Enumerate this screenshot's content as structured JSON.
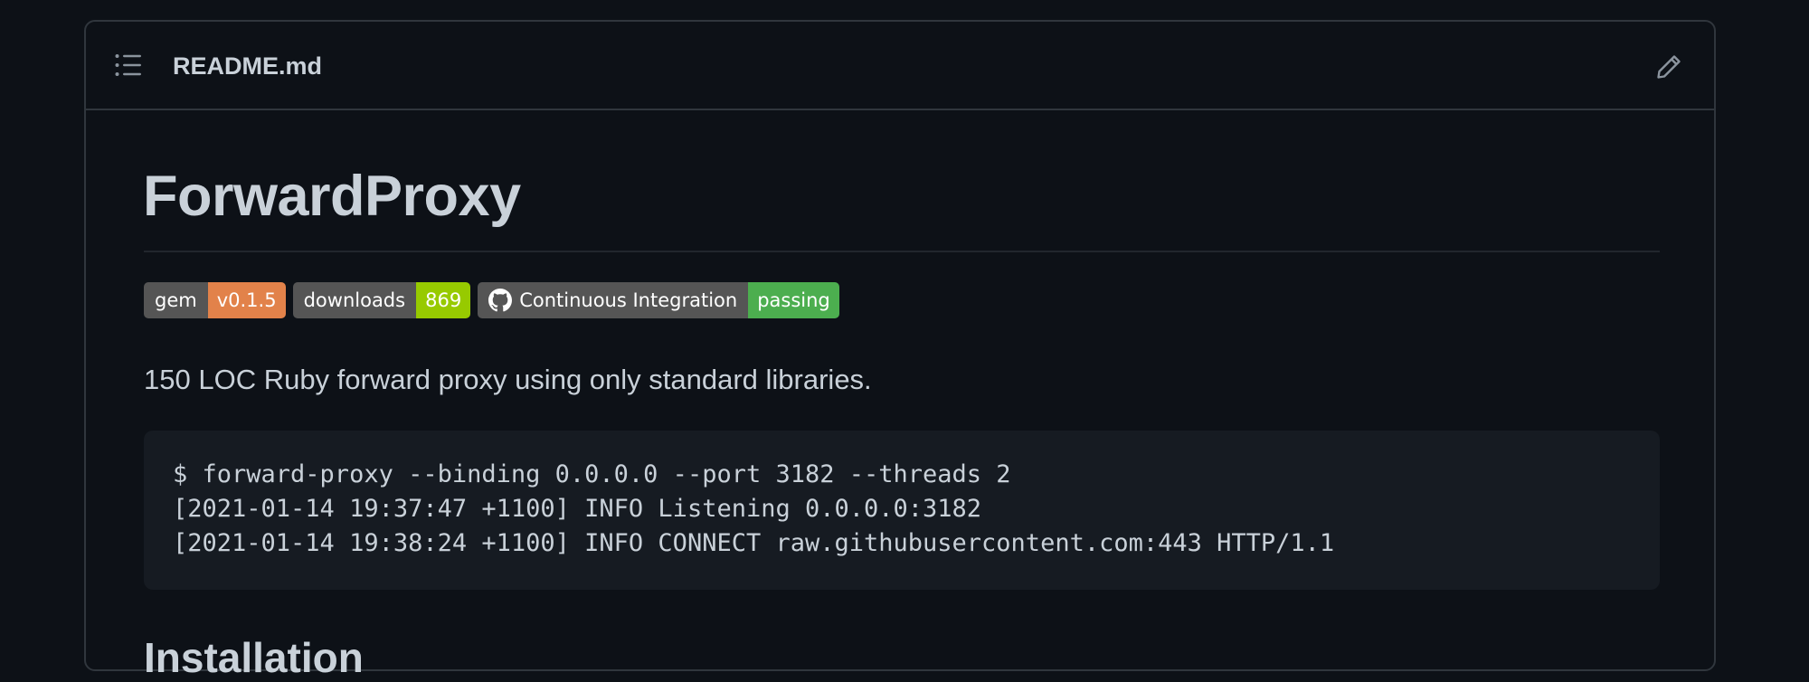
{
  "header": {
    "file_name": "README.md",
    "toc_icon": "list-unordered-icon",
    "edit_icon": "pencil-icon"
  },
  "readme": {
    "title": "ForwardProxy",
    "badges": [
      {
        "label": "gem",
        "value": "v0.1.5",
        "color": "#e2824a",
        "icon": ""
      },
      {
        "label": "downloads",
        "value": "869",
        "color": "#97ca00",
        "icon": ""
      },
      {
        "label": "Continuous Integration",
        "value": "passing",
        "color": "#4c1",
        "icon": "github-icon"
      }
    ],
    "description": "150 LOC Ruby forward proxy using only standard libraries.",
    "code_lines": [
      "$ forward-proxy --binding 0.0.0.0 --port 3182 --threads 2",
      "[2021-01-14 19:37:47 +1100] INFO Listening 0.0.0.0:3182",
      "[2021-01-14 19:38:24 +1100] INFO CONNECT raw.githubusercontent.com:443 HTTP/1.1"
    ],
    "section_heading": "Installation"
  },
  "colors": {
    "background": "#0d1117",
    "border": "#30363d",
    "text": "#c9d1d9",
    "code_bg": "#161b22",
    "badge_gem": "#e2824a",
    "badge_downloads": "#97ca00",
    "badge_ci": "#4cae4f"
  }
}
